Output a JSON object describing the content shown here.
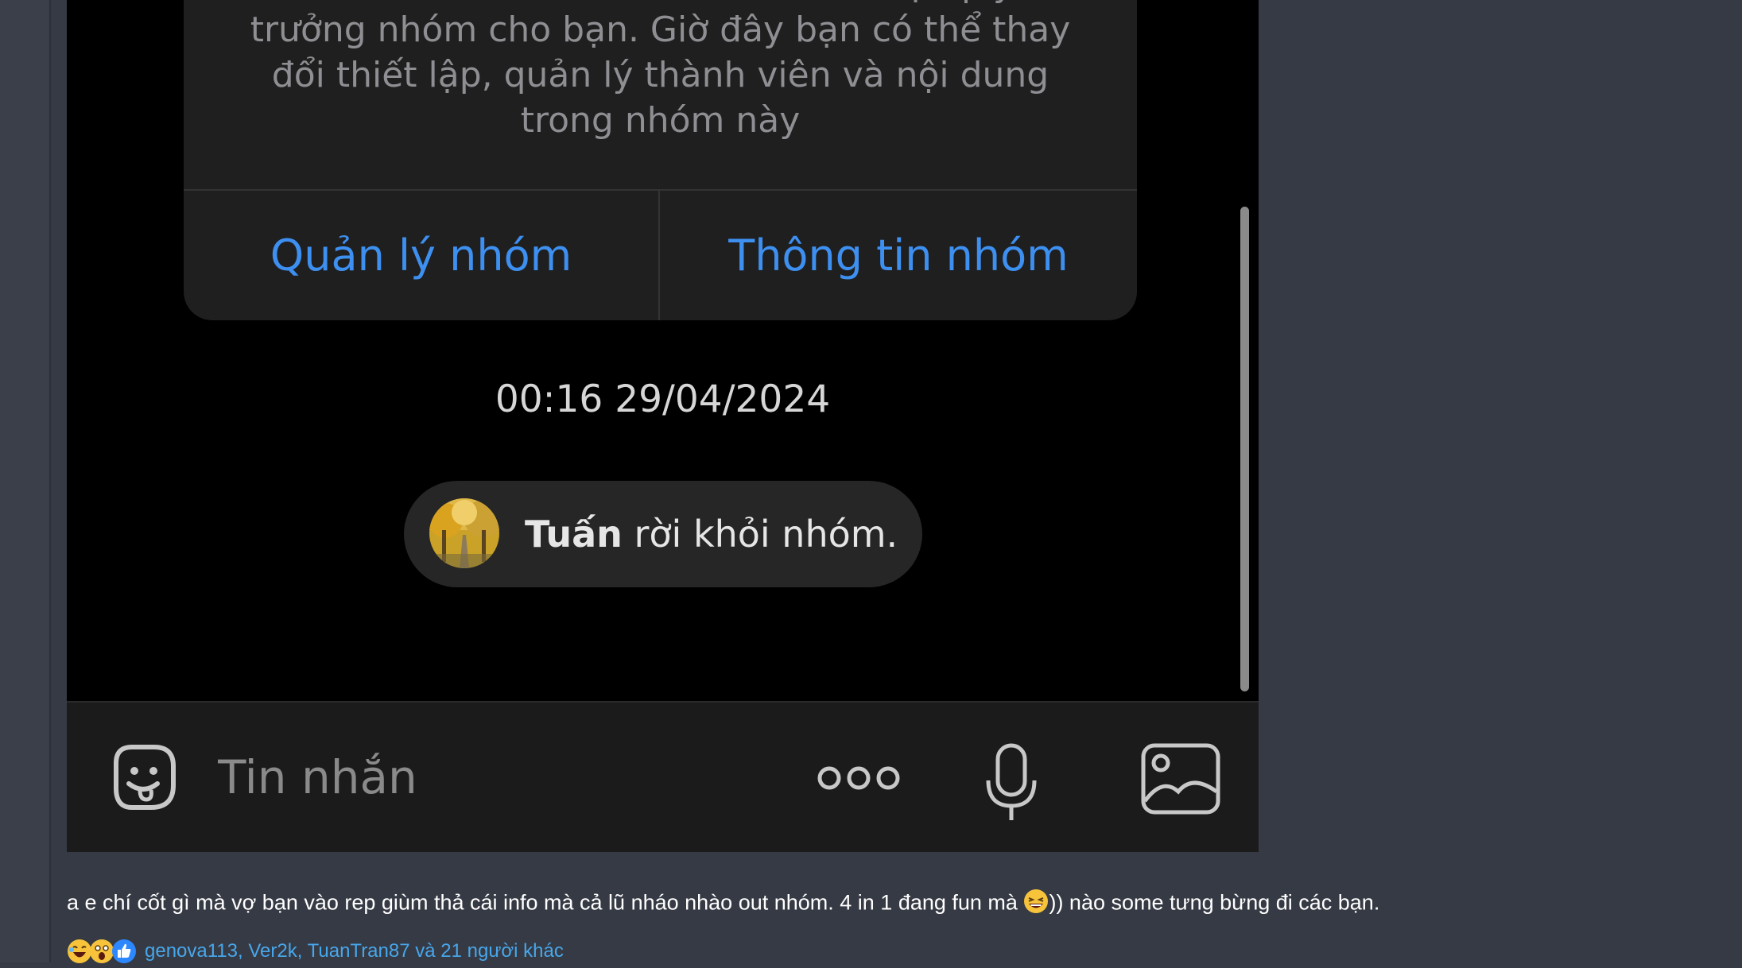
{
  "screenshot": {
    "card_text_lines": [
      "Trần Hoài Đức vừa rời nhóm và trao lại quyền",
      "trưởng nhóm cho bạn. Giờ đây bạn có thể thay",
      "đổi thiết lập, quản lý thành viên và nội dung",
      "trong nhóm này"
    ],
    "manage_group_label": "Quản lý nhóm",
    "group_info_label": "Thông tin nhóm",
    "timestamp": "00:16 29/04/2024",
    "leave_name": "Tuấn",
    "leave_text": "rời khỏi nhóm.",
    "message_placeholder": "Tin nhắn"
  },
  "post": {
    "text_before_emoji": "a e chí cốt gì mà vợ bạn vào rep giùm thả cái info mà cả lũ nháo nhào out nhóm. 4 in 1 đang fun mà",
    "emoji": "grinning-squint-emoji",
    "text_after_emoji": ")) nào some tưng bừng đi các bạn.",
    "reactions": [
      "laugh-react-icon",
      "wow-react-icon",
      "like-react-icon"
    ],
    "reactors_text": "genova113, Ver2k, TuanTran87 và 21 người khác"
  },
  "colors": {
    "page_bg": "#363a44",
    "accent_blue": "#3d8ff0",
    "link_blue": "#47a7eb"
  }
}
